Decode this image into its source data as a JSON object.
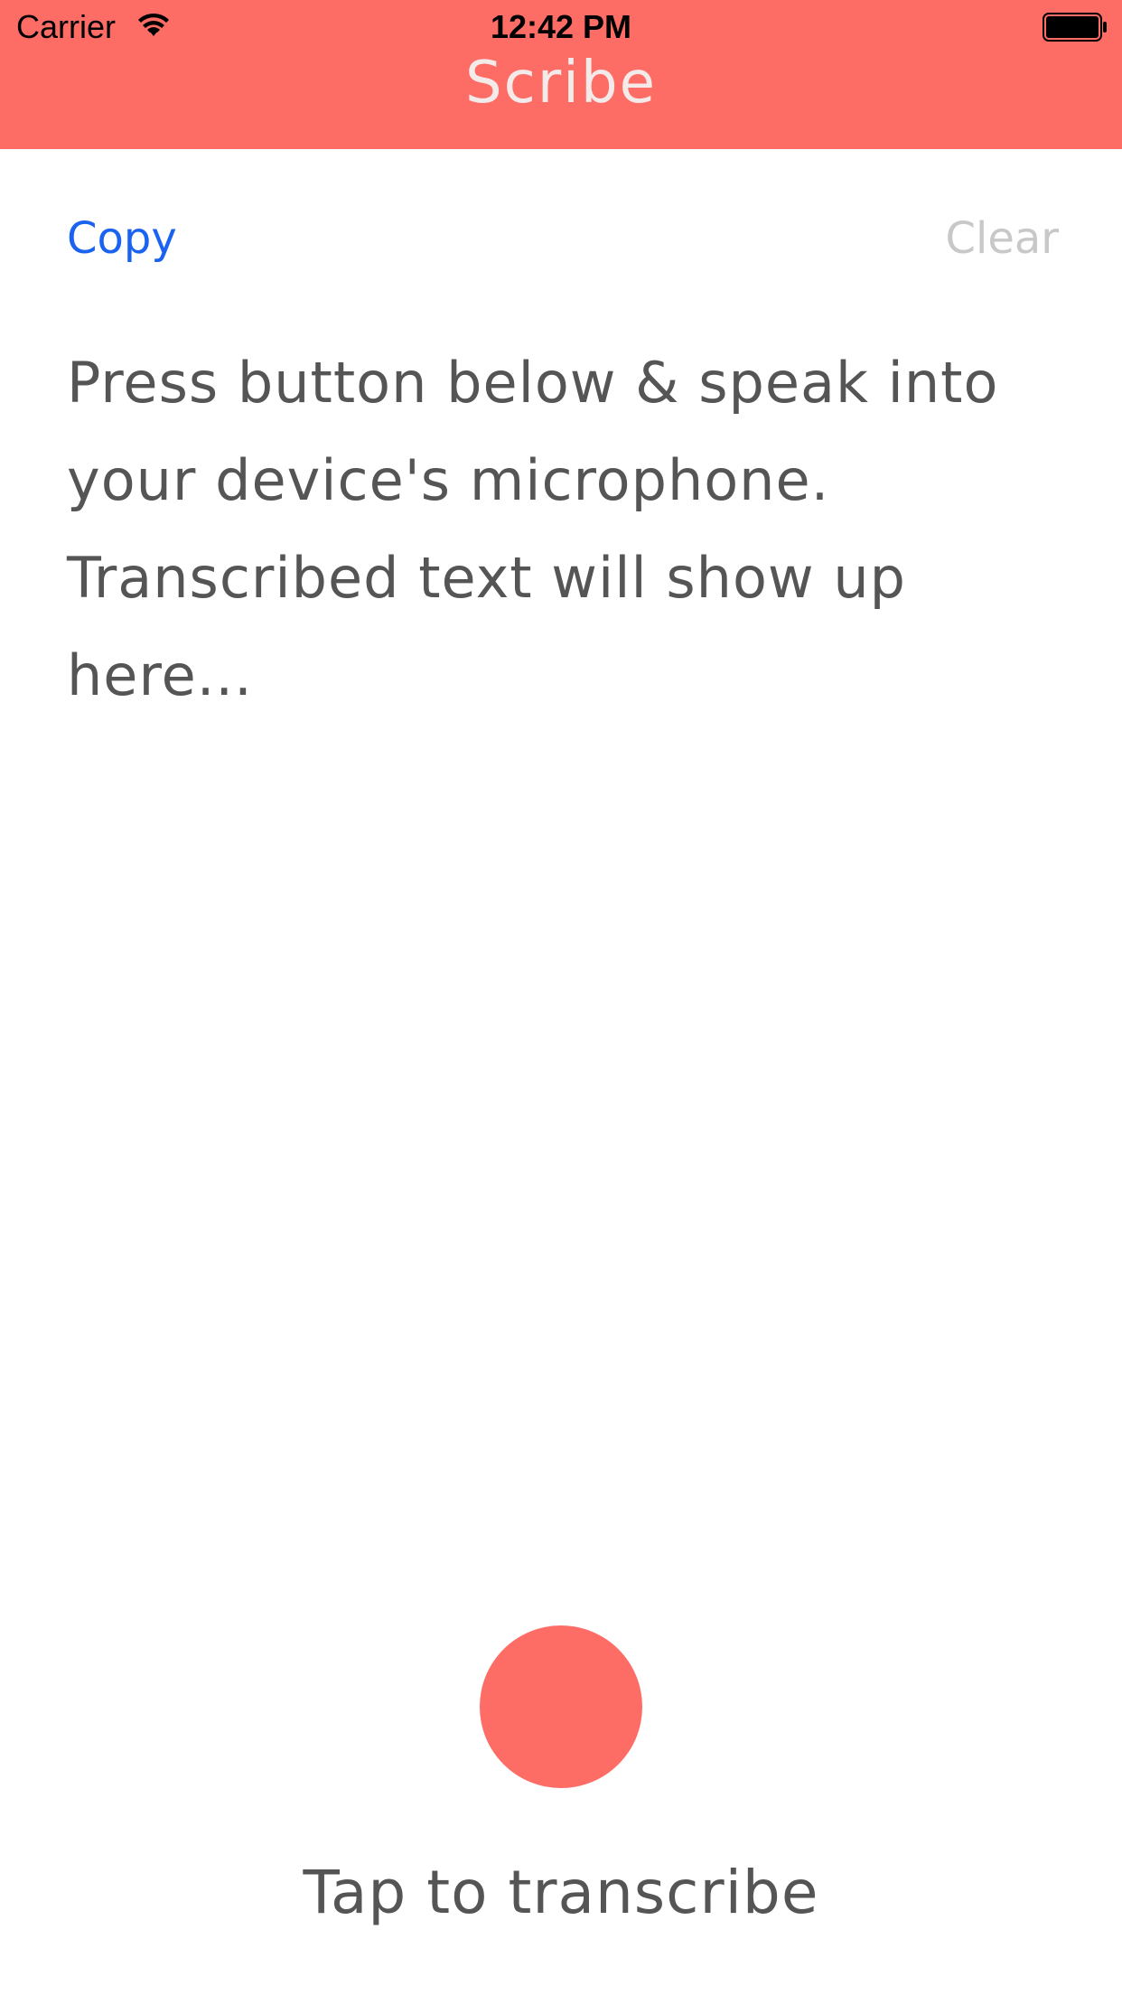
{
  "status_bar": {
    "carrier": "Carrier",
    "time": "12:42 PM",
    "icons": [
      "wifi-icon",
      "battery-icon"
    ]
  },
  "header": {
    "title": "Scribe"
  },
  "toolbar": {
    "copy_label": "Copy",
    "clear_label": "Clear"
  },
  "transcript": {
    "placeholder_text": "Press button below & speak into your device's microphone. Transcribed text will show up here..."
  },
  "record": {
    "caption": "Tap to transcribe"
  },
  "colors": {
    "accent": "#fe6c66",
    "link": "#1a62f0",
    "disabled": "#c8c8c8",
    "body_text": "#555555"
  }
}
